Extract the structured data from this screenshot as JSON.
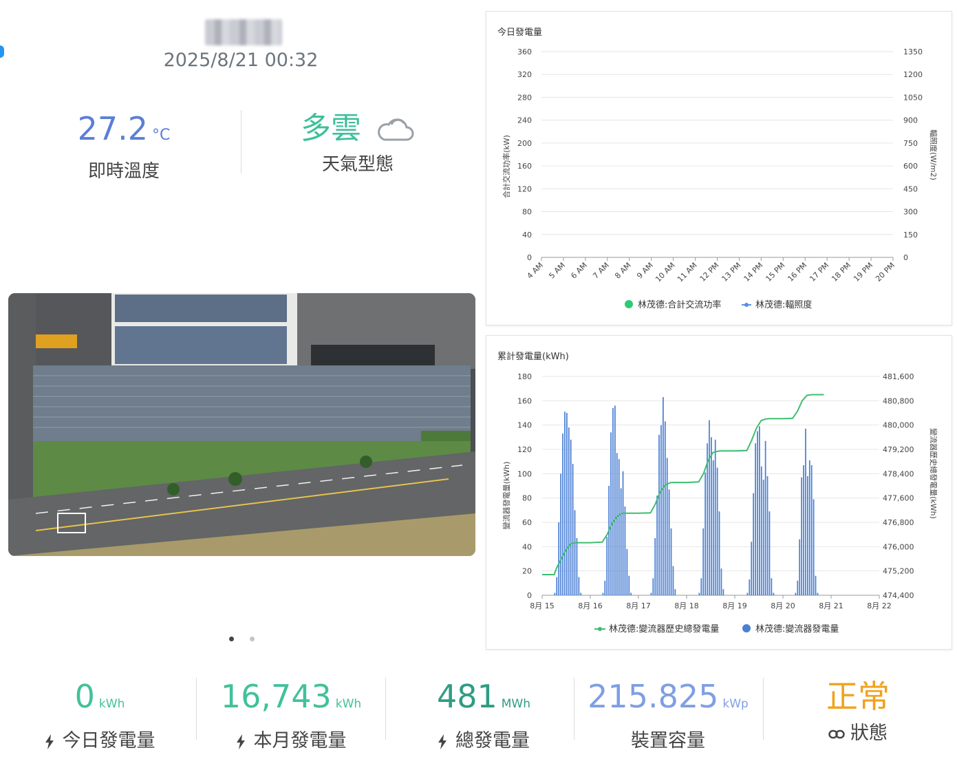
{
  "header": {
    "datetime": "2025/8/21 00:32"
  },
  "weather": {
    "temperature": "27.2",
    "temperature_unit": "°C",
    "temperature_label": "即時溫度",
    "condition": "多雲",
    "condition_icon": "cloud-icon",
    "condition_label": "天氣型態"
  },
  "carousel": {
    "slide_count": 2,
    "active_index": 0
  },
  "chart_data": [
    {
      "type": "line",
      "title": "今日發電量",
      "ylabel": "合計交流功率(kW)",
      "ylabel_right": "輻照度(W/m2)",
      "ylim": [
        0,
        360
      ],
      "yticks": [
        0,
        40,
        80,
        120,
        160,
        200,
        240,
        280,
        320,
        360
      ],
      "ylim_right": [
        0,
        1350
      ],
      "yticks_right": [
        0,
        150,
        300,
        450,
        600,
        750,
        900,
        1050,
        1200,
        1350
      ],
      "categories": [
        "4 AM",
        "5 AM",
        "6 AM",
        "7 AM",
        "8 AM",
        "9 AM",
        "10 AM",
        "11 AM",
        "12 PM",
        "13 PM",
        "14 PM",
        "15 PM",
        "16 PM",
        "17 PM",
        "18 PM",
        "19 PM",
        "20 PM"
      ],
      "series": [
        {
          "name": "林茂德:合計交流功率",
          "color": "#2ecc71",
          "values": []
        },
        {
          "name": "林茂德:輻照度",
          "color": "#5b8fe0",
          "values": []
        }
      ],
      "grid": true,
      "legend": "bottom"
    },
    {
      "type": "bar",
      "title": "累計發電量(kWh)",
      "ylabel": "變流器發電量(kWh)",
      "ylabel_right": "變流器歷史總發電量(kWh)",
      "ylim": [
        0,
        180
      ],
      "yticks": [
        0,
        20,
        40,
        60,
        80,
        100,
        120,
        140,
        160,
        180
      ],
      "ylim_right": [
        474400,
        481600
      ],
      "yticks_right": [
        "474,400",
        "475,200",
        "476,000",
        "476,800",
        "477,600",
        "478,400",
        "479,200",
        "480,000",
        "480,800",
        "481,600"
      ],
      "yticks_right_values": [
        474400,
        475200,
        476000,
        476800,
        477600,
        478400,
        479200,
        480000,
        480800,
        481600
      ],
      "xlim": [
        0,
        7
      ],
      "xticks": [
        "8月 15",
        "8月 16",
        "8月 17",
        "8月 18",
        "8月 19",
        "8月 20",
        "8月 21",
        "8月 22"
      ],
      "bar_series": {
        "name": "林茂德:變流器發電量",
        "color": "#4a7fd4",
        "days": [
          [
            2,
            15,
            60,
            100,
            133,
            151,
            150,
            138,
            128,
            108,
            70,
            47,
            15,
            2
          ],
          [
            2,
            12,
            48,
            90,
            134,
            154,
            156,
            117,
            112,
            88,
            102,
            73,
            38,
            16,
            2
          ],
          [
            2,
            14,
            47,
            82,
            132,
            140,
            163,
            143,
            113,
            87,
            55,
            24,
            5
          ],
          [
            2,
            14,
            55,
            101,
            125,
            144,
            130,
            111,
            128,
            105,
            69,
            22,
            5
          ],
          [
            2,
            13,
            44,
            84,
            125,
            135,
            139,
            106,
            95,
            127,
            98,
            69,
            14,
            2
          ],
          [
            2,
            12,
            46,
            97,
            107,
            137,
            98,
            111,
            107,
            79,
            16,
            2
          ]
        ]
      },
      "line_series": {
        "name": "林茂德:變流器歷史總發電量",
        "color": "#3dbd6e",
        "points": [
          [
            0.0,
            475080
          ],
          [
            0.25,
            475080
          ],
          [
            0.3,
            475300
          ],
          [
            0.4,
            475600
          ],
          [
            0.5,
            475900
          ],
          [
            0.6,
            476100
          ],
          [
            0.7,
            476130
          ],
          [
            1.0,
            476130
          ],
          [
            1.25,
            476150
          ],
          [
            1.35,
            476400
          ],
          [
            1.45,
            476750
          ],
          [
            1.55,
            476980
          ],
          [
            1.65,
            477090
          ],
          [
            1.7,
            477100
          ],
          [
            2.0,
            477100
          ],
          [
            2.25,
            477110
          ],
          [
            2.35,
            477400
          ],
          [
            2.45,
            477800
          ],
          [
            2.55,
            478020
          ],
          [
            2.65,
            478100
          ],
          [
            2.7,
            478110
          ],
          [
            3.0,
            478110
          ],
          [
            3.25,
            478130
          ],
          [
            3.35,
            478400
          ],
          [
            3.45,
            478850
          ],
          [
            3.55,
            479100
          ],
          [
            3.65,
            479140
          ],
          [
            3.7,
            479150
          ],
          [
            4.0,
            479150
          ],
          [
            4.25,
            479160
          ],
          [
            4.35,
            479500
          ],
          [
            4.45,
            479900
          ],
          [
            4.55,
            480150
          ],
          [
            4.65,
            480200
          ],
          [
            4.7,
            480210
          ],
          [
            5.0,
            480210
          ],
          [
            5.2,
            480220
          ],
          [
            5.3,
            480450
          ],
          [
            5.4,
            480800
          ],
          [
            5.5,
            480980
          ],
          [
            5.6,
            481000
          ],
          [
            5.85,
            481000
          ]
        ]
      },
      "grid": true,
      "legend": "bottom"
    }
  ],
  "stats": [
    {
      "value": "0",
      "unit": "kWh",
      "label": "今日發電量",
      "icon": "bolt-icon"
    },
    {
      "value": "16,743",
      "unit": "kWh",
      "label": "本月發電量",
      "icon": "bolt-icon"
    },
    {
      "value": "481",
      "unit": "MWh",
      "label": "總發電量",
      "icon": "bolt-icon"
    },
    {
      "value": "215.825",
      "unit": "kWp",
      "label": "裝置容量",
      "icon": ""
    },
    {
      "value": "正常",
      "unit": "",
      "label": "狀態",
      "icon": "link-icon"
    }
  ],
  "colors": {
    "temperature": "#5b7fd6",
    "weather": "#3fbf9a",
    "stat_today": "#42c19b",
    "stat_month": "#42c19b",
    "stat_total": "#2f9c83",
    "stat_capacity": "#7f9fe3",
    "stat_status": "#f0a21d"
  }
}
